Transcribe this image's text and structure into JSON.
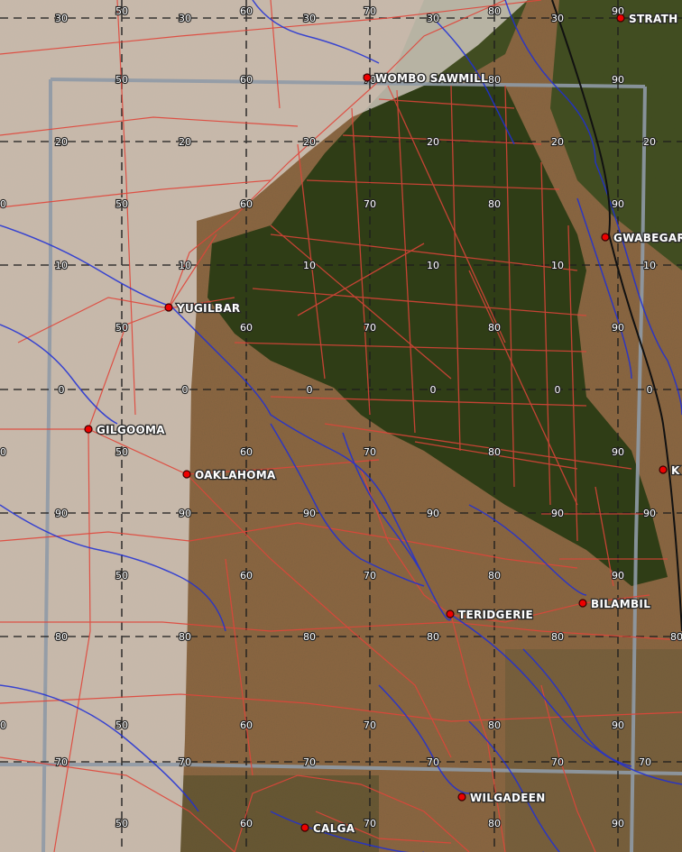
{
  "map": {
    "colors": {
      "terrain_brown": "#8c6640",
      "forest": "#2f3d16",
      "pale_overlay": "#d8cfc8",
      "road": "#e0453a",
      "river": "#1f2fd6",
      "grid_line": "#1e1e1e",
      "map_frame": "#8f9aa6",
      "railway": "#111111",
      "town_marker": "#ee0000"
    },
    "towns": [
      {
        "id": "strath",
        "name": "STRATH"
      },
      {
        "id": "wombo-sawmill",
        "name": "WOMBO SAWMILL"
      },
      {
        "id": "gwabegar",
        "name": "GWABEGAR"
      },
      {
        "id": "yugilbar",
        "name": "YUGILBAR"
      },
      {
        "id": "gilgooma",
        "name": "GILGOOMA"
      },
      {
        "id": "oaklahoma",
        "name": "OAKLAHOMA"
      },
      {
        "id": "k",
        "name": "K"
      },
      {
        "id": "teridgerie",
        "name": "TERIDGERIE"
      },
      {
        "id": "bilambil",
        "name": "BILAMBIL"
      },
      {
        "id": "wilgadeen",
        "name": "WILGADEEN"
      },
      {
        "id": "calga",
        "name": "CALGA"
      }
    ],
    "grid_labels": [
      "30",
      "50",
      "30",
      "60",
      "30",
      "70",
      "30",
      "80",
      "30",
      "90",
      "50",
      "60",
      "70",
      "80",
      "90",
      "20",
      "20",
      "20",
      "20",
      "20",
      "20",
      "50",
      "60",
      "70",
      "80",
      "90",
      "90",
      "10",
      "10",
      "10",
      "10",
      "10",
      "10",
      "50",
      "60",
      "70",
      "80",
      "90",
      "0",
      "0",
      "0",
      "0",
      "0",
      "0",
      "50",
      "60",
      "70",
      "80",
      "90",
      "90",
      "90",
      "90",
      "90",
      "90",
      "90",
      "90",
      "50",
      "60",
      "70",
      "80",
      "90",
      "80",
      "80",
      "80",
      "80",
      "80",
      "80",
      "50",
      "60",
      "70",
      "80",
      "90",
      "90",
      "70",
      "70",
      "70",
      "70",
      "70",
      "70",
      "50",
      "60",
      "70",
      "80",
      "90"
    ]
  }
}
